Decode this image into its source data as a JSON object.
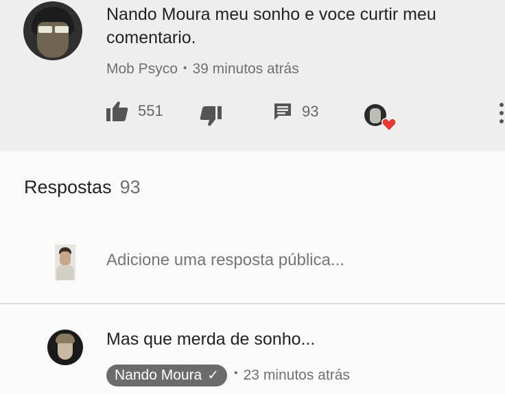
{
  "comment": {
    "text": "Nando Moura meu sonho e voce curtir meu comentario.",
    "author": "Mob Psyco",
    "separator": "•",
    "time": "39 minutos atrás",
    "likes": "551",
    "replies_count": "93"
  },
  "replies_section": {
    "title": "Respostas",
    "count": "93",
    "input_placeholder": "Adicione uma resposta pública..."
  },
  "reply": {
    "text": "Mas que merda de sonho...",
    "author": "Nando Moura",
    "verified_mark": "✓",
    "separator": "•",
    "time": "23 minutos atrás"
  },
  "colors": {
    "top_background": "#eeeeee",
    "page_background": "#fafafa",
    "heart": "#e53935",
    "author_chip": "#6b6b6b"
  },
  "icons": [
    "thumbs-up-icon",
    "thumbs-down-icon",
    "comment-icon",
    "creator-heart-icon",
    "more-vertical-icon"
  ]
}
